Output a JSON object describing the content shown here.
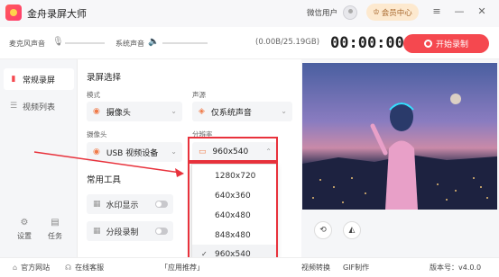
{
  "titlebar": {
    "app_title": "金舟录屏大师",
    "wechat_user": "微信用户",
    "vip_label": "会员中心"
  },
  "audio": {
    "mic_label": "麦克风声音",
    "system_label": "系统声音",
    "storage": "(0.00B/25.19GB)",
    "timer": "00:00:00",
    "start_label": "开始录制"
  },
  "sidebar": {
    "items": [
      {
        "label": "常规录屏",
        "icon": "record-icon"
      },
      {
        "label": "视频列表",
        "icon": "list-icon"
      }
    ],
    "bottom": [
      {
        "label": "设置",
        "icon": "gear-icon"
      },
      {
        "label": "任务",
        "icon": "task-icon"
      }
    ]
  },
  "settings": {
    "section_title": "录屏选择",
    "mode": {
      "label": "模式",
      "value": "摄像头"
    },
    "audio_source": {
      "label": "声源",
      "value": "仅系统声音"
    },
    "camera": {
      "label": "摄像头",
      "value": "USB 视频设备"
    },
    "resolution": {
      "label": "分辨率",
      "value": "960x540"
    }
  },
  "tools": {
    "section_title": "常用工具",
    "items": [
      {
        "label": "水印显示",
        "on": false
      },
      {
        "label": "分段录制",
        "on": false
      }
    ]
  },
  "resolution_dropdown": {
    "options": [
      "1280x720",
      "640x360",
      "640x480",
      "848x480",
      "960x540"
    ],
    "selected": "960x540"
  },
  "footer": {
    "website": "官方网站",
    "support": "在线客服",
    "app_rec_partial": "「应用推荐」",
    "video_convert": "视频转换",
    "gif": "GIF制作",
    "version": "版本号：v4.0.0"
  },
  "colors": {
    "accent": "#f5484f",
    "highlight": "#e8323c",
    "vip_bg": "#fde9cf"
  }
}
